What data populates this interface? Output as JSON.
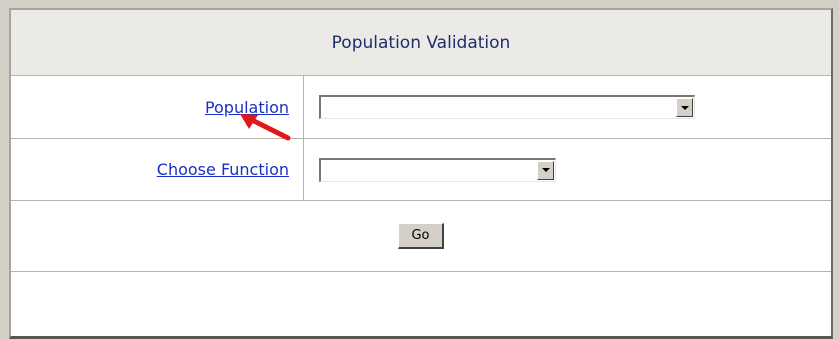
{
  "header": {
    "title": "Population Validation"
  },
  "form": {
    "population_label": "Population",
    "population_value": "",
    "function_label": "Choose Function",
    "function_value": "",
    "go_label": "Go"
  },
  "annotation": {
    "arrow_color": "#e01818"
  },
  "icons": [
    "dropdown-arrow-icon",
    "red-pointer-arrow-icon"
  ]
}
